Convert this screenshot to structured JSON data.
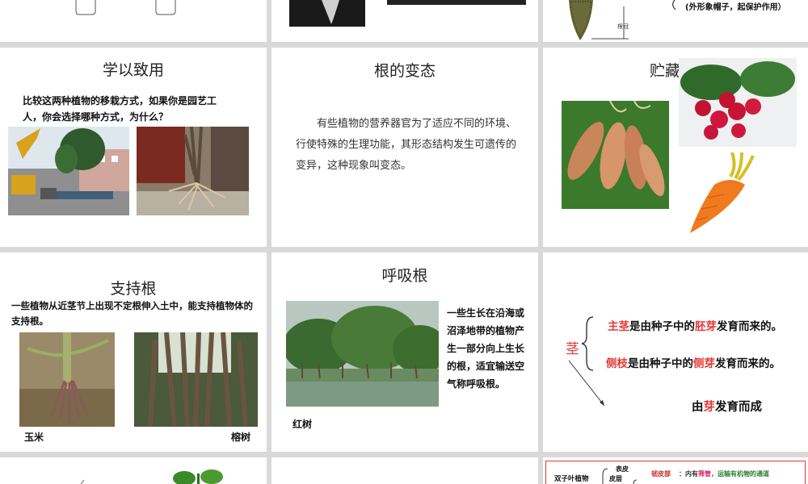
{
  "row1": {
    "slide3": {
      "note": "(外形象帽子，起保护作用）",
      "root_cap_label": "根冠"
    }
  },
  "slide_apply": {
    "title": "学以致用",
    "question": "比较这两种植物的移栽方式，如果你是园艺工人，你会选择哪种方式，为什么？"
  },
  "slide_metamorph": {
    "title": "根的变态",
    "body": "有些植物的营养器官为了适应不同的环境、行使特殊的生理功能，其形态结构发生可遗传的变异，这种现象叫变态。"
  },
  "slide_storage": {
    "title": "贮藏"
  },
  "slide_support": {
    "title": "支持根",
    "body": "一些植物从近茎节上出现不定根伸入土中，能支持植物体的支持根。",
    "label_left": "玉米",
    "label_right": "榕树"
  },
  "slide_breath": {
    "title": "呼吸根",
    "body": "一些生长在沿海或沼泽地带的植物产生一部分向上生长的根，适宜输送空气称呼吸根。",
    "caption": "红树"
  },
  "slide_stem": {
    "stem_label": "茎",
    "line1_pre": "主茎",
    "line1_mid": "是由种子中的",
    "line1_red": "胚芽",
    "line1_post": "发育而来的。",
    "line2_pre": "侧枝",
    "line2_mid": "是由种子中的",
    "line2_red": "侧芽",
    "line2_post": "发育而来的。",
    "line3_pre": "由",
    "line3_red": "芽",
    "line3_post": "发育而成"
  },
  "row4": {
    "dicot_label": "双子叶植物",
    "epidermis": "表皮",
    "cortex": "皮层",
    "phloem": "韧皮部",
    "phloem_desc_a": "：内有",
    "phloem_desc_b": "筛管",
    "phloem_desc_c": "，运输有机物的通道"
  },
  "colors": {
    "accent_red": "#e53935",
    "gap": "#d9d9d9"
  }
}
